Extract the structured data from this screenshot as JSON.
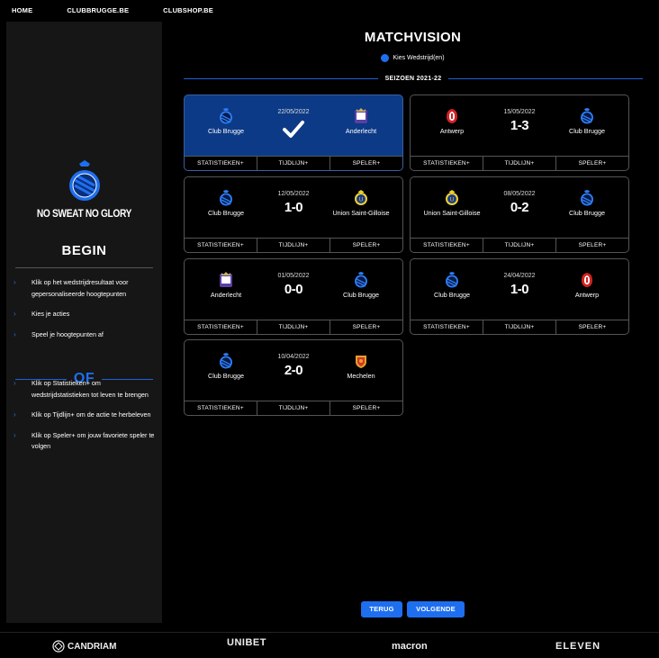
{
  "nav": {
    "home": "HOME",
    "clubbrugge": "CLUBBRUGGE.BE",
    "clubshop": "CLUBSHOP.BE"
  },
  "sidebar": {
    "slogan": "NO SWEAT NO GLORY",
    "begin": "BEGIN",
    "steps": [
      "Klik op het wedstrijdresultaat voor gepersonaliseerde hoogtepunten",
      "Kies je acties",
      "Speel je hoogtepunten af"
    ],
    "of": "OF",
    "steps2": [
      "Klik op Statistieken+ om wedstrijdstatistieken tot leven te brengen",
      "Klik op Tijdlijn+ om de actie te herbeleven",
      "Klik op Speler+ om jouw favoriete speler te volgen"
    ]
  },
  "main": {
    "title": "MATCHVISION",
    "picker": "Kies Wedstrijd(en)",
    "season": "SEIZOEN 2021-22",
    "buttons": {
      "stats": "STATISTIEKEN+",
      "timeline": "TIJDLIJN+",
      "player": "SPELER+"
    },
    "matches": [
      {
        "date": "22/05/2022",
        "score": "",
        "home": "Club Brugge",
        "away": "Anderlecht",
        "selected": true,
        "home_badge": "club-brugge",
        "away_badge": "anderlecht"
      },
      {
        "date": "15/05/2022",
        "score": "1-3",
        "home": "Antwerp",
        "away": "Club Brugge",
        "selected": false,
        "home_badge": "antwerp",
        "away_badge": "club-brugge"
      },
      {
        "date": "12/05/2022",
        "score": "1-0",
        "home": "Club Brugge",
        "away": "Union Saint-Gilloise",
        "selected": false,
        "home_badge": "club-brugge",
        "away_badge": "union"
      },
      {
        "date": "08/05/2022",
        "score": "0-2",
        "home": "Union Saint-Gilloise",
        "away": "Club Brugge",
        "selected": false,
        "home_badge": "union",
        "away_badge": "club-brugge"
      },
      {
        "date": "01/05/2022",
        "score": "0-0",
        "home": "Anderlecht",
        "away": "Club Brugge",
        "selected": false,
        "home_badge": "anderlecht",
        "away_badge": "club-brugge"
      },
      {
        "date": "24/04/2022",
        "score": "1-0",
        "home": "Club Brugge",
        "away": "Antwerp",
        "selected": false,
        "home_badge": "club-brugge",
        "away_badge": "antwerp"
      },
      {
        "date": "10/04/2022",
        "score": "2-0",
        "home": "Club Brugge",
        "away": "Mechelen",
        "selected": false,
        "home_badge": "club-brugge",
        "away_badge": "mechelen"
      }
    ],
    "back": "TERUG",
    "next": "VOLGENDE"
  },
  "sponsors": [
    "CANDRIAM",
    "UNIBET",
    "macron",
    "ELEVEN"
  ],
  "colors": {
    "accent": "#1e6ff0",
    "selected_card": "#0c3a86"
  }
}
